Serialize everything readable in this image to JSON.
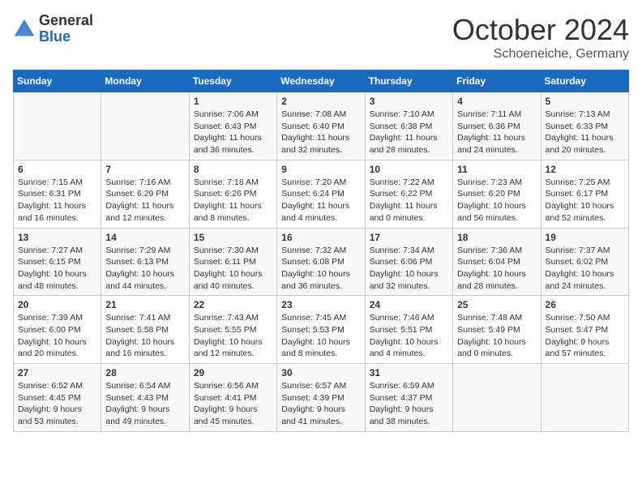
{
  "header": {
    "logo_general": "General",
    "logo_blue": "Blue",
    "month_title": "October 2024",
    "location": "Schoeneiche, Germany"
  },
  "days_of_week": [
    "Sunday",
    "Monday",
    "Tuesday",
    "Wednesday",
    "Thursday",
    "Friday",
    "Saturday"
  ],
  "weeks": [
    [
      {
        "day": "",
        "info": ""
      },
      {
        "day": "",
        "info": ""
      },
      {
        "day": "1",
        "info": "Sunrise: 7:06 AM\nSunset: 6:43 PM\nDaylight: 11 hours\nand 36 minutes."
      },
      {
        "day": "2",
        "info": "Sunrise: 7:08 AM\nSunset: 6:40 PM\nDaylight: 11 hours\nand 32 minutes."
      },
      {
        "day": "3",
        "info": "Sunrise: 7:10 AM\nSunset: 6:38 PM\nDaylight: 11 hours\nand 28 minutes."
      },
      {
        "day": "4",
        "info": "Sunrise: 7:11 AM\nSunset: 6:36 PM\nDaylight: 11 hours\nand 24 minutes."
      },
      {
        "day": "5",
        "info": "Sunrise: 7:13 AM\nSunset: 6:33 PM\nDaylight: 11 hours\nand 20 minutes."
      }
    ],
    [
      {
        "day": "6",
        "info": "Sunrise: 7:15 AM\nSunset: 6:31 PM\nDaylight: 11 hours\nand 16 minutes."
      },
      {
        "day": "7",
        "info": "Sunrise: 7:16 AM\nSunset: 6:29 PM\nDaylight: 11 hours\nand 12 minutes."
      },
      {
        "day": "8",
        "info": "Sunrise: 7:18 AM\nSunset: 6:26 PM\nDaylight: 11 hours\nand 8 minutes."
      },
      {
        "day": "9",
        "info": "Sunrise: 7:20 AM\nSunset: 6:24 PM\nDaylight: 11 hours\nand 4 minutes."
      },
      {
        "day": "10",
        "info": "Sunrise: 7:22 AM\nSunset: 6:22 PM\nDaylight: 11 hours\nand 0 minutes."
      },
      {
        "day": "11",
        "info": "Sunrise: 7:23 AM\nSunset: 6:20 PM\nDaylight: 10 hours\nand 56 minutes."
      },
      {
        "day": "12",
        "info": "Sunrise: 7:25 AM\nSunset: 6:17 PM\nDaylight: 10 hours\nand 52 minutes."
      }
    ],
    [
      {
        "day": "13",
        "info": "Sunrise: 7:27 AM\nSunset: 6:15 PM\nDaylight: 10 hours\nand 48 minutes."
      },
      {
        "day": "14",
        "info": "Sunrise: 7:29 AM\nSunset: 6:13 PM\nDaylight: 10 hours\nand 44 minutes."
      },
      {
        "day": "15",
        "info": "Sunrise: 7:30 AM\nSunset: 6:11 PM\nDaylight: 10 hours\nand 40 minutes."
      },
      {
        "day": "16",
        "info": "Sunrise: 7:32 AM\nSunset: 6:08 PM\nDaylight: 10 hours\nand 36 minutes."
      },
      {
        "day": "17",
        "info": "Sunrise: 7:34 AM\nSunset: 6:06 PM\nDaylight: 10 hours\nand 32 minutes."
      },
      {
        "day": "18",
        "info": "Sunrise: 7:36 AM\nSunset: 6:04 PM\nDaylight: 10 hours\nand 28 minutes."
      },
      {
        "day": "19",
        "info": "Sunrise: 7:37 AM\nSunset: 6:02 PM\nDaylight: 10 hours\nand 24 minutes."
      }
    ],
    [
      {
        "day": "20",
        "info": "Sunrise: 7:39 AM\nSunset: 6:00 PM\nDaylight: 10 hours\nand 20 minutes."
      },
      {
        "day": "21",
        "info": "Sunrise: 7:41 AM\nSunset: 5:58 PM\nDaylight: 10 hours\nand 16 minutes."
      },
      {
        "day": "22",
        "info": "Sunrise: 7:43 AM\nSunset: 5:55 PM\nDaylight: 10 hours\nand 12 minutes."
      },
      {
        "day": "23",
        "info": "Sunrise: 7:45 AM\nSunset: 5:53 PM\nDaylight: 10 hours\nand 8 minutes."
      },
      {
        "day": "24",
        "info": "Sunrise: 7:46 AM\nSunset: 5:51 PM\nDaylight: 10 hours\nand 4 minutes."
      },
      {
        "day": "25",
        "info": "Sunrise: 7:48 AM\nSunset: 5:49 PM\nDaylight: 10 hours\nand 0 minutes."
      },
      {
        "day": "26",
        "info": "Sunrise: 7:50 AM\nSunset: 5:47 PM\nDaylight: 9 hours\nand 57 minutes."
      }
    ],
    [
      {
        "day": "27",
        "info": "Sunrise: 6:52 AM\nSunset: 4:45 PM\nDaylight: 9 hours\nand 53 minutes."
      },
      {
        "day": "28",
        "info": "Sunrise: 6:54 AM\nSunset: 4:43 PM\nDaylight: 9 hours\nand 49 minutes."
      },
      {
        "day": "29",
        "info": "Sunrise: 6:56 AM\nSunset: 4:41 PM\nDaylight: 9 hours\nand 45 minutes."
      },
      {
        "day": "30",
        "info": "Sunrise: 6:57 AM\nSunset: 4:39 PM\nDaylight: 9 hours\nand 41 minutes."
      },
      {
        "day": "31",
        "info": "Sunrise: 6:59 AM\nSunset: 4:37 PM\nDaylight: 9 hours\nand 38 minutes."
      },
      {
        "day": "",
        "info": ""
      },
      {
        "day": "",
        "info": ""
      }
    ]
  ]
}
